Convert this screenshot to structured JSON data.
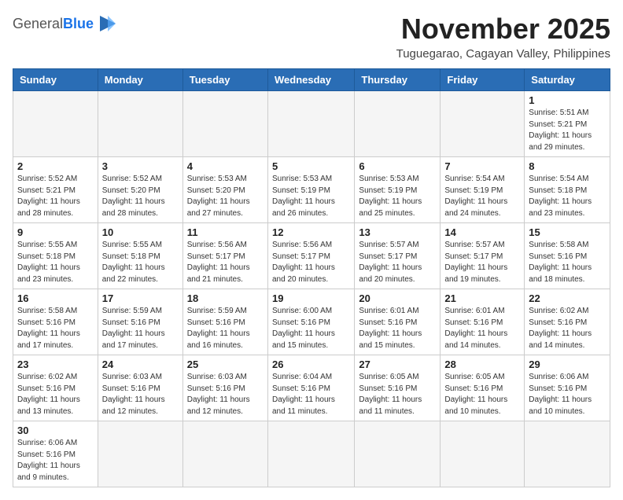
{
  "header": {
    "logo_general": "General",
    "logo_blue": "Blue",
    "month_title": "November 2025",
    "location": "Tuguegarao, Cagayan Valley, Philippines"
  },
  "weekdays": [
    "Sunday",
    "Monday",
    "Tuesday",
    "Wednesday",
    "Thursday",
    "Friday",
    "Saturday"
  ],
  "days": [
    {
      "date": "",
      "info": ""
    },
    {
      "date": "",
      "info": ""
    },
    {
      "date": "",
      "info": ""
    },
    {
      "date": "",
      "info": ""
    },
    {
      "date": "",
      "info": ""
    },
    {
      "date": "",
      "info": ""
    },
    {
      "date": "1",
      "info": "Sunrise: 5:51 AM\nSunset: 5:21 PM\nDaylight: 11 hours\nand 29 minutes."
    },
    {
      "date": "2",
      "info": "Sunrise: 5:52 AM\nSunset: 5:21 PM\nDaylight: 11 hours\nand 28 minutes."
    },
    {
      "date": "3",
      "info": "Sunrise: 5:52 AM\nSunset: 5:20 PM\nDaylight: 11 hours\nand 28 minutes."
    },
    {
      "date": "4",
      "info": "Sunrise: 5:53 AM\nSunset: 5:20 PM\nDaylight: 11 hours\nand 27 minutes."
    },
    {
      "date": "5",
      "info": "Sunrise: 5:53 AM\nSunset: 5:19 PM\nDaylight: 11 hours\nand 26 minutes."
    },
    {
      "date": "6",
      "info": "Sunrise: 5:53 AM\nSunset: 5:19 PM\nDaylight: 11 hours\nand 25 minutes."
    },
    {
      "date": "7",
      "info": "Sunrise: 5:54 AM\nSunset: 5:19 PM\nDaylight: 11 hours\nand 24 minutes."
    },
    {
      "date": "8",
      "info": "Sunrise: 5:54 AM\nSunset: 5:18 PM\nDaylight: 11 hours\nand 23 minutes."
    },
    {
      "date": "9",
      "info": "Sunrise: 5:55 AM\nSunset: 5:18 PM\nDaylight: 11 hours\nand 23 minutes."
    },
    {
      "date": "10",
      "info": "Sunrise: 5:55 AM\nSunset: 5:18 PM\nDaylight: 11 hours\nand 22 minutes."
    },
    {
      "date": "11",
      "info": "Sunrise: 5:56 AM\nSunset: 5:17 PM\nDaylight: 11 hours\nand 21 minutes."
    },
    {
      "date": "12",
      "info": "Sunrise: 5:56 AM\nSunset: 5:17 PM\nDaylight: 11 hours\nand 20 minutes."
    },
    {
      "date": "13",
      "info": "Sunrise: 5:57 AM\nSunset: 5:17 PM\nDaylight: 11 hours\nand 20 minutes."
    },
    {
      "date": "14",
      "info": "Sunrise: 5:57 AM\nSunset: 5:17 PM\nDaylight: 11 hours\nand 19 minutes."
    },
    {
      "date": "15",
      "info": "Sunrise: 5:58 AM\nSunset: 5:16 PM\nDaylight: 11 hours\nand 18 minutes."
    },
    {
      "date": "16",
      "info": "Sunrise: 5:58 AM\nSunset: 5:16 PM\nDaylight: 11 hours\nand 17 minutes."
    },
    {
      "date": "17",
      "info": "Sunrise: 5:59 AM\nSunset: 5:16 PM\nDaylight: 11 hours\nand 17 minutes."
    },
    {
      "date": "18",
      "info": "Sunrise: 5:59 AM\nSunset: 5:16 PM\nDaylight: 11 hours\nand 16 minutes."
    },
    {
      "date": "19",
      "info": "Sunrise: 6:00 AM\nSunset: 5:16 PM\nDaylight: 11 hours\nand 15 minutes."
    },
    {
      "date": "20",
      "info": "Sunrise: 6:01 AM\nSunset: 5:16 PM\nDaylight: 11 hours\nand 15 minutes."
    },
    {
      "date": "21",
      "info": "Sunrise: 6:01 AM\nSunset: 5:16 PM\nDaylight: 11 hours\nand 14 minutes."
    },
    {
      "date": "22",
      "info": "Sunrise: 6:02 AM\nSunset: 5:16 PM\nDaylight: 11 hours\nand 14 minutes."
    },
    {
      "date": "23",
      "info": "Sunrise: 6:02 AM\nSunset: 5:16 PM\nDaylight: 11 hours\nand 13 minutes."
    },
    {
      "date": "24",
      "info": "Sunrise: 6:03 AM\nSunset: 5:16 PM\nDaylight: 11 hours\nand 12 minutes."
    },
    {
      "date": "25",
      "info": "Sunrise: 6:03 AM\nSunset: 5:16 PM\nDaylight: 11 hours\nand 12 minutes."
    },
    {
      "date": "26",
      "info": "Sunrise: 6:04 AM\nSunset: 5:16 PM\nDaylight: 11 hours\nand 11 minutes."
    },
    {
      "date": "27",
      "info": "Sunrise: 6:05 AM\nSunset: 5:16 PM\nDaylight: 11 hours\nand 11 minutes."
    },
    {
      "date": "28",
      "info": "Sunrise: 6:05 AM\nSunset: 5:16 PM\nDaylight: 11 hours\nand 10 minutes."
    },
    {
      "date": "29",
      "info": "Sunrise: 6:06 AM\nSunset: 5:16 PM\nDaylight: 11 hours\nand 10 minutes."
    },
    {
      "date": "30",
      "info": "Sunrise: 6:06 AM\nSunset: 5:16 PM\nDaylight: 11 hours\nand 9 minutes."
    },
    {
      "date": "",
      "info": ""
    },
    {
      "date": "",
      "info": ""
    },
    {
      "date": "",
      "info": ""
    },
    {
      "date": "",
      "info": ""
    },
    {
      "date": "",
      "info": ""
    },
    {
      "date": "",
      "info": ""
    }
  ]
}
